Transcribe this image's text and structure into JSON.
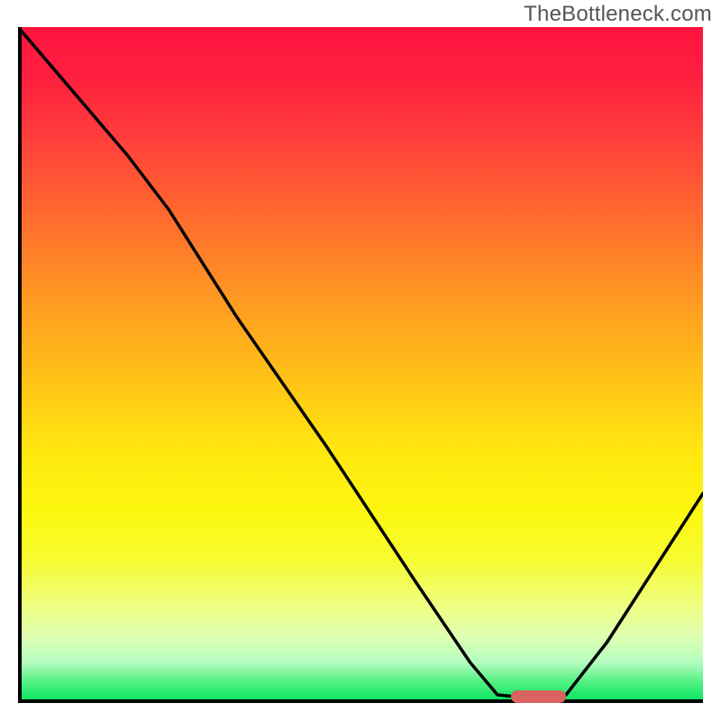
{
  "chart_data": {
    "type": "line",
    "title": "",
    "xlabel": "",
    "ylabel": "",
    "watermark": "TheBottleneck.com",
    "x_range": [
      0,
      100
    ],
    "y_range": [
      0,
      100
    ],
    "gradient_meaning": "top = high bottleneck (red), bottom = optimal (green)",
    "curve_points": [
      {
        "x": 0,
        "y": 100
      },
      {
        "x": 16,
        "y": 81
      },
      {
        "x": 22,
        "y": 73
      },
      {
        "x": 32,
        "y": 57
      },
      {
        "x": 45,
        "y": 38
      },
      {
        "x": 58,
        "y": 18
      },
      {
        "x": 66,
        "y": 6
      },
      {
        "x": 70,
        "y": 1.2
      },
      {
        "x": 72,
        "y": 1.0
      },
      {
        "x": 78,
        "y": 1.0
      },
      {
        "x": 80,
        "y": 1.2
      },
      {
        "x": 86,
        "y": 9
      },
      {
        "x": 93,
        "y": 20
      },
      {
        "x": 100,
        "y": 31
      }
    ],
    "optimal_marker": {
      "x_start": 72,
      "x_end": 80,
      "y": 1.0,
      "color": "#d9635f"
    },
    "colors": {
      "worst": "#ff143f",
      "mid": "#ffe80f",
      "best": "#00e45e",
      "marker": "#d9635f",
      "axis": "#000000",
      "curve": "#000000"
    }
  }
}
